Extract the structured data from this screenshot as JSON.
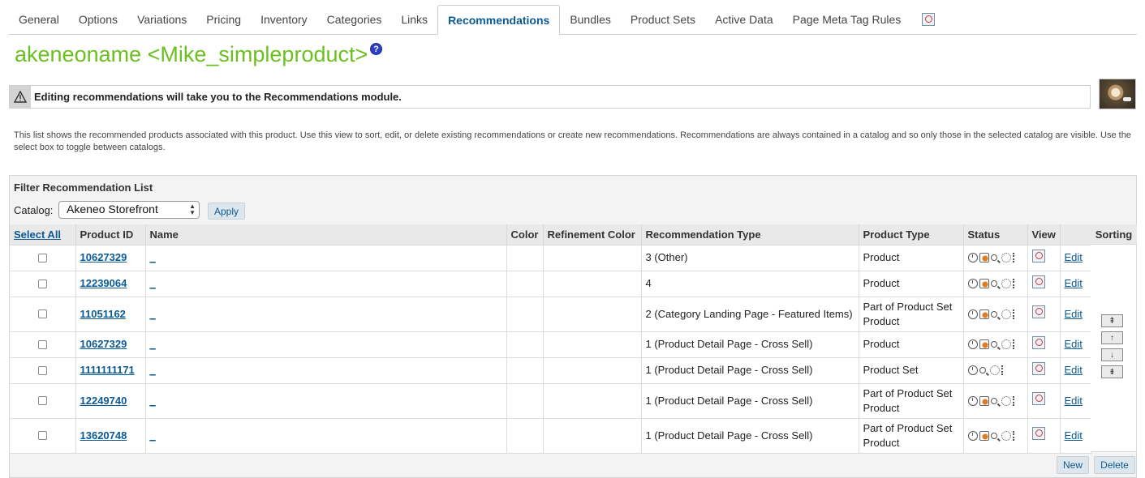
{
  "tabs": [
    "General",
    "Options",
    "Variations",
    "Pricing",
    "Inventory",
    "Categories",
    "Links",
    "Recommendations",
    "Bundles",
    "Product Sets",
    "Active Data",
    "Page Meta Tag Rules"
  ],
  "active_tab": "Recommendations",
  "page_title": "akeneoname <Mike_simpleproduct>",
  "help_icon_label": "?",
  "warning": "Editing recommendations will take you to the Recommendations module.",
  "description": "This list shows the recommended products associated with this product. Use this view to sort, edit, or delete existing recommendations or create new recommendations. Recommendations are always contained in a catalog and so only those in the selected catalog are visible. Use the select box to toggle between catalogs.",
  "filter": {
    "title": "Filter Recommendation List",
    "catalog_label": "Catalog:",
    "catalog_value": "Akeneo Storefront",
    "apply_label": "Apply"
  },
  "table": {
    "headers": {
      "select_all": "Select All",
      "product_id": "Product ID",
      "name": "Name",
      "color": "Color",
      "refinement_color": "Refinement Color",
      "recommendation_type": "Recommendation Type",
      "product_type": "Product Type",
      "status": "Status",
      "view": "View",
      "edit": "",
      "sorting": "Sorting"
    },
    "rows": [
      {
        "product_id": "10627329",
        "name": "_",
        "rec_type": "3 (Other)",
        "product_type": "Product",
        "edit": "Edit"
      },
      {
        "product_id": "12239064",
        "name": "_",
        "rec_type": "4",
        "product_type": "Product",
        "edit": "Edit"
      },
      {
        "product_id": "11051162",
        "name": "_",
        "rec_type": "2 (Category Landing Page - Featured Items)",
        "product_type": "Part of Product Set Product",
        "edit": "Edit"
      },
      {
        "product_id": "10627329",
        "name": "_",
        "rec_type": "1 (Product Detail Page - Cross Sell)",
        "product_type": "Product",
        "edit": "Edit"
      },
      {
        "product_id": "1111111171",
        "name": "_",
        "rec_type": "1 (Product Detail Page - Cross Sell)",
        "product_type": "Product Set",
        "edit": "Edit"
      },
      {
        "product_id": "12249740",
        "name": "_",
        "rec_type": "1 (Product Detail Page - Cross Sell)",
        "product_type": "Part of Product Set Product",
        "edit": "Edit"
      },
      {
        "product_id": "13620748",
        "name": "_",
        "rec_type": "1 (Product Detail Page - Cross Sell)",
        "product_type": "Part of Product Set Product",
        "edit": "Edit"
      }
    ]
  },
  "sort_buttons": [
    "⇞",
    "↑",
    "↓",
    "⇟"
  ],
  "buttons": {
    "new": "New",
    "delete": "Delete"
  }
}
